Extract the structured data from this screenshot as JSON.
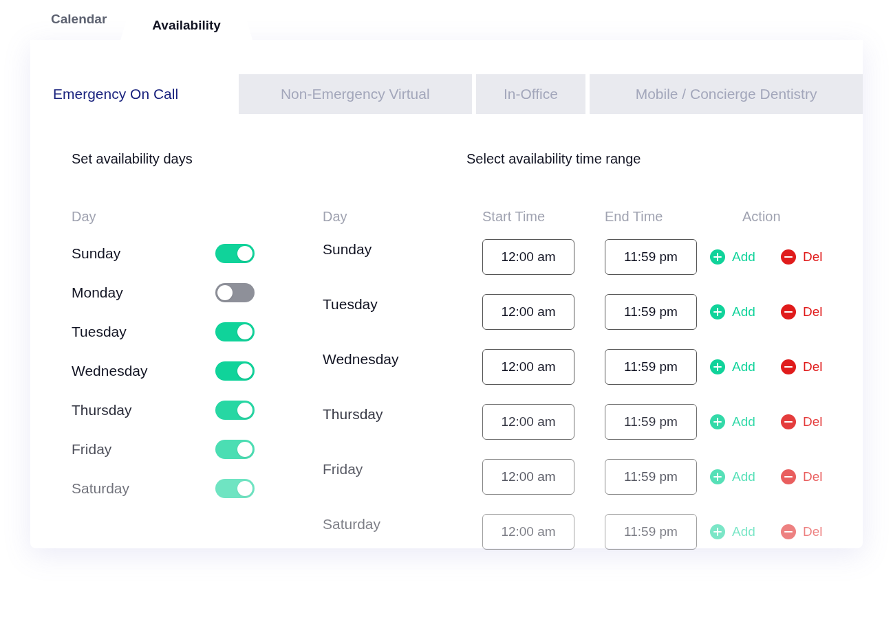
{
  "top_tabs": [
    {
      "label": "Calendar",
      "selected": false
    },
    {
      "label": "Availability",
      "selected": true
    }
  ],
  "service_tabs": [
    {
      "label": "Emergency On Call",
      "selected": true
    },
    {
      "label": "Non-Emergency Virtual",
      "selected": false
    },
    {
      "label": "In-Office",
      "selected": false
    },
    {
      "label": "Mobile / Concierge Dentistry",
      "selected": false
    }
  ],
  "days_panel": {
    "title": "Set availability days",
    "column": "Day",
    "days": [
      {
        "name": "Sunday",
        "on": true
      },
      {
        "name": "Monday",
        "on": false
      },
      {
        "name": "Tuesday",
        "on": true
      },
      {
        "name": "Wednesday",
        "on": true
      },
      {
        "name": "Thursday",
        "on": true
      },
      {
        "name": "Friday",
        "on": true
      },
      {
        "name": "Saturday",
        "on": true
      }
    ]
  },
  "time_panel": {
    "title": "Select availability time range",
    "columns": [
      "Day",
      "Start Time",
      "End Time",
      "Action"
    ],
    "rows": [
      {
        "day": "Sunday",
        "start": "12:00 am",
        "end": "11:59 pm",
        "add": "Add",
        "delete": "Del"
      },
      {
        "day": "Tuesday",
        "start": "12:00 am",
        "end": "11:59 pm",
        "add": "Add",
        "delete": "Del"
      },
      {
        "day": "Wednesday",
        "start": "12:00 am",
        "end": "11:59 pm",
        "add": "Add",
        "delete": "Del"
      },
      {
        "day": "Thursday",
        "start": "12:00 am",
        "end": "11:59 pm",
        "add": "Add",
        "delete": "Del"
      },
      {
        "day": "Friday",
        "start": "12:00 am",
        "end": "11:59 pm",
        "add": "Add",
        "delete": "Del"
      },
      {
        "day": "Saturday",
        "start": "12:00 am",
        "end": "11:59 pm",
        "add": "Add",
        "delete": "Del"
      }
    ]
  }
}
